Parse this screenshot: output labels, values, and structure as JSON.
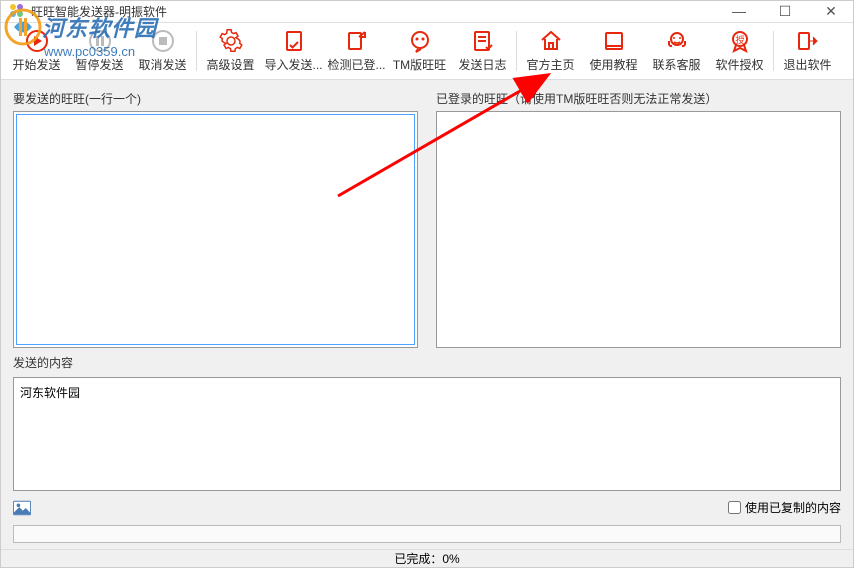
{
  "window": {
    "title": "旺旺智能发送器-明振软件"
  },
  "toolbar": [
    {
      "id": "start-send",
      "label": "开始发送"
    },
    {
      "id": "pause-send",
      "label": "暂停发送",
      "disabled": true
    },
    {
      "id": "cancel-send",
      "label": "取消发送",
      "disabled": true
    },
    {
      "id": "advanced-settings",
      "label": "高级设置"
    },
    {
      "id": "import-send",
      "label": "导入发送..."
    },
    {
      "id": "check-login",
      "label": "检测已登..."
    },
    {
      "id": "tm-wangwang",
      "label": "TM版旺旺"
    },
    {
      "id": "send-log",
      "label": "发送日志"
    },
    {
      "id": "official-home",
      "label": "官方主页"
    },
    {
      "id": "tutorial",
      "label": "使用教程"
    },
    {
      "id": "customer-service",
      "label": "联系客服"
    },
    {
      "id": "authorize",
      "label": "软件授权"
    },
    {
      "id": "exit",
      "label": "退出软件"
    }
  ],
  "left_panel": {
    "label": "要发送的旺旺(一行一个)",
    "value": ""
  },
  "right_panel": {
    "label": "已登录的旺旺（请使用TM版旺旺否则无法正常发送）"
  },
  "content_panel": {
    "label": "发送的内容",
    "value": "河东软件园"
  },
  "checkbox": {
    "label": "使用已复制的内容",
    "checked": false
  },
  "status": {
    "text": "已完成：0%"
  },
  "watermark": {
    "text": "河东软件园",
    "url": "www.pc0359.cn"
  }
}
